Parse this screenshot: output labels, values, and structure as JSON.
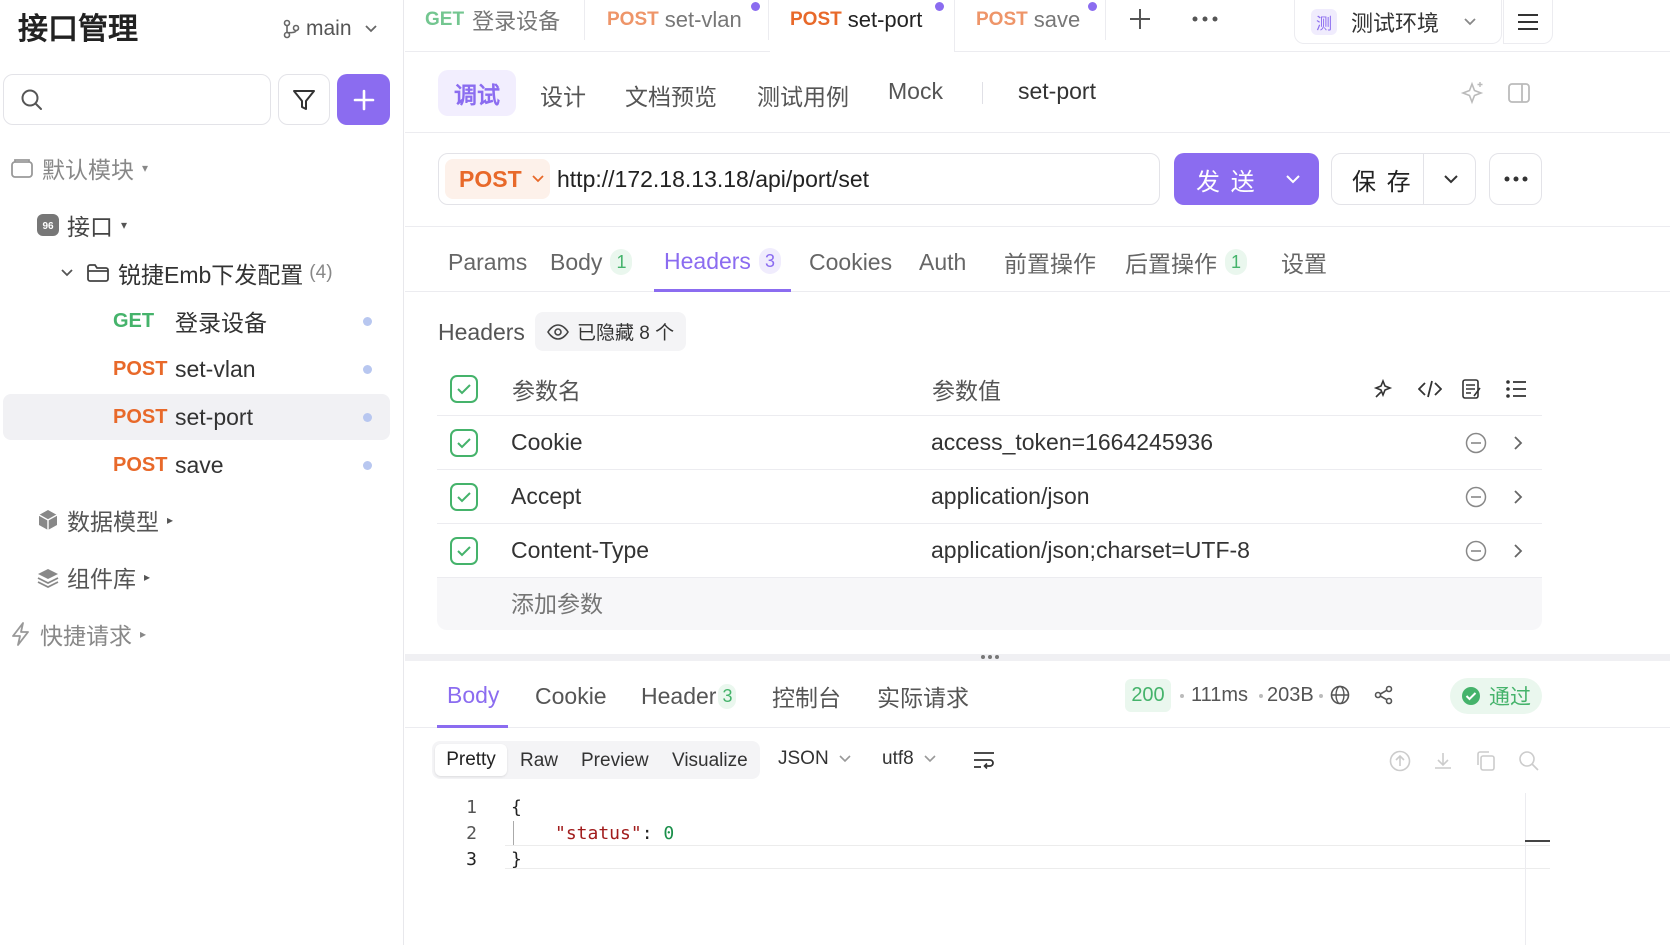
{
  "sidebar": {
    "title": "接口管理",
    "branch": "main",
    "search_placeholder": "",
    "tree": {
      "default_module": "默认模块",
      "api_root": "接口",
      "folder_name": "锐捷Emb下发配置",
      "folder_count": "(4)",
      "items": [
        {
          "method": "GET",
          "name": "登录设备"
        },
        {
          "method": "POST",
          "name": "set-vlan"
        },
        {
          "method": "POST",
          "name": "set-port"
        },
        {
          "method": "POST",
          "name": "save"
        }
      ],
      "data_models": "数据模型",
      "components": "组件库",
      "quick_request": "快捷请求"
    }
  },
  "tabs": [
    {
      "method": "GET",
      "name": "登录设备"
    },
    {
      "method": "POST",
      "name": "set-vlan"
    },
    {
      "method": "POST",
      "name": "set-port"
    },
    {
      "method": "POST",
      "name": "save"
    }
  ],
  "env": {
    "badge": "测",
    "name": "测试环境"
  },
  "mode_tabs": {
    "debug": "调试",
    "design": "设计",
    "doc_preview": "文档预览",
    "test_cases": "测试用例",
    "mock": "Mock",
    "api_name": "set-port"
  },
  "request": {
    "method": "POST",
    "url": "http://172.18.13.18/api/port/set",
    "send_label": "发 送",
    "save_label": "保 存"
  },
  "req_tabs": {
    "params": "Params",
    "body": "Body",
    "body_count": "1",
    "headers": "Headers",
    "headers_count": "3",
    "cookies": "Cookies",
    "auth": "Auth",
    "pre": "前置操作",
    "post": "后置操作",
    "post_count": "1",
    "settings": "设置"
  },
  "headers": {
    "label": "Headers",
    "hidden_label": "已隐藏 8 个",
    "col_name": "参数名",
    "col_value": "参数值",
    "rows": [
      {
        "name": "Cookie",
        "value": "access_token=1664245936"
      },
      {
        "name": "Accept",
        "value": "application/json"
      },
      {
        "name": "Content-Type",
        "value": "application/json;charset=UTF-8"
      }
    ],
    "add_placeholder": "添加参数"
  },
  "response": {
    "tabs": {
      "body": "Body",
      "cookie": "Cookie",
      "header": "Header",
      "header_count": "3",
      "console": "控制台",
      "actual": "实际请求"
    },
    "status": "200",
    "time": "111ms",
    "size": "203B",
    "pass_label": "通过",
    "view_modes": {
      "pretty": "Pretty",
      "raw": "Raw",
      "preview": "Preview",
      "visualize": "Visualize"
    },
    "format": "JSON",
    "encoding": "utf8",
    "code": {
      "line_numbers": [
        "1",
        "2",
        "3"
      ],
      "open_brace": "{",
      "key": "\"status\"",
      "colon": ": ",
      "value": "0",
      "close_brace": "}"
    }
  },
  "colors": {
    "accent": "#8b6cf0",
    "get": "#45b36b",
    "post": "#e8692a",
    "pass": "#45b36b"
  }
}
